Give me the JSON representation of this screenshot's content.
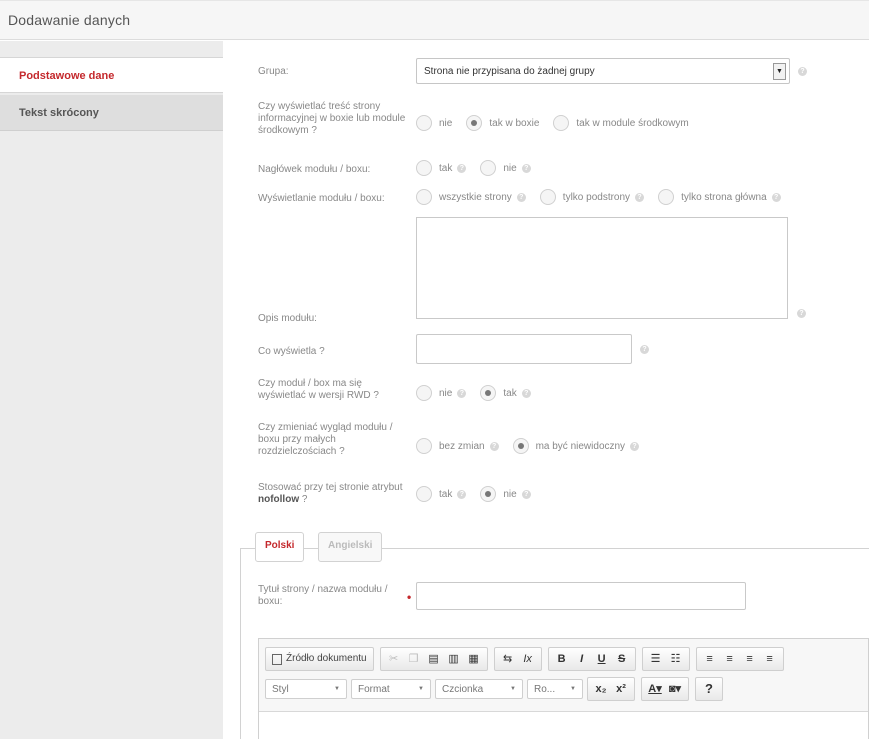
{
  "header": {
    "title": "Dodawanie danych"
  },
  "sidebar": {
    "items": [
      {
        "label": "Podstawowe dane"
      },
      {
        "label": "Tekst skrócony"
      }
    ]
  },
  "form": {
    "grupa": {
      "label": "Grupa:",
      "selected": "Strona nie przypisana do żadnej grupy"
    },
    "show_content": {
      "label": "Czy wyświetlać treść strony informacyjnej w boxie lub module środkowym ?",
      "options": [
        "nie",
        "tak w boxie",
        "tak w module środkowym"
      ],
      "selected": "tak w boxie"
    },
    "header_module": {
      "label": "Nagłówek modułu / boxu:",
      "options": [
        "tak",
        "nie"
      ]
    },
    "display_module": {
      "label": "Wyświetlanie modułu / boxu:",
      "options": [
        "wszystkie strony",
        "tylko podstrony",
        "tylko strona główna"
      ]
    },
    "description": {
      "label": "Opis modułu:",
      "value": ""
    },
    "what_shows": {
      "label": "Co wyświetla ?",
      "value": ""
    },
    "rwd": {
      "label": "Czy moduł / box ma się wyświetlać w wersji RWD ?",
      "options": [
        "nie",
        "tak"
      ],
      "selected": "tak"
    },
    "small_res": {
      "label": "Czy zmieniać wygląd modułu / boxu przy małych rozdzielczościach ?",
      "options": [
        "bez zmian",
        "ma być niewidoczny"
      ],
      "selected": "ma być niewidoczny"
    },
    "nofollow": {
      "label_prefix": "Stosować przy tej stronie atrybut ",
      "label_bold": "nofollow",
      "label_suffix": " ?",
      "options": [
        "tak",
        "nie"
      ],
      "selected": "nie"
    }
  },
  "lang_tabs": [
    {
      "label": "Polski"
    },
    {
      "label": "Angielski"
    }
  ],
  "title_field": {
    "label": "Tytuł strony / nazwa modułu / boxu:",
    "value": ""
  },
  "editor": {
    "source_label": "Źródło dokumentu",
    "style_label": "Styl",
    "format_label": "Format",
    "font_label": "Czcionka",
    "size_label": "Ro...",
    "bold": "B",
    "italic": "I",
    "underline": "U",
    "strike": "S",
    "help": "?"
  },
  "help_glyph": "?"
}
